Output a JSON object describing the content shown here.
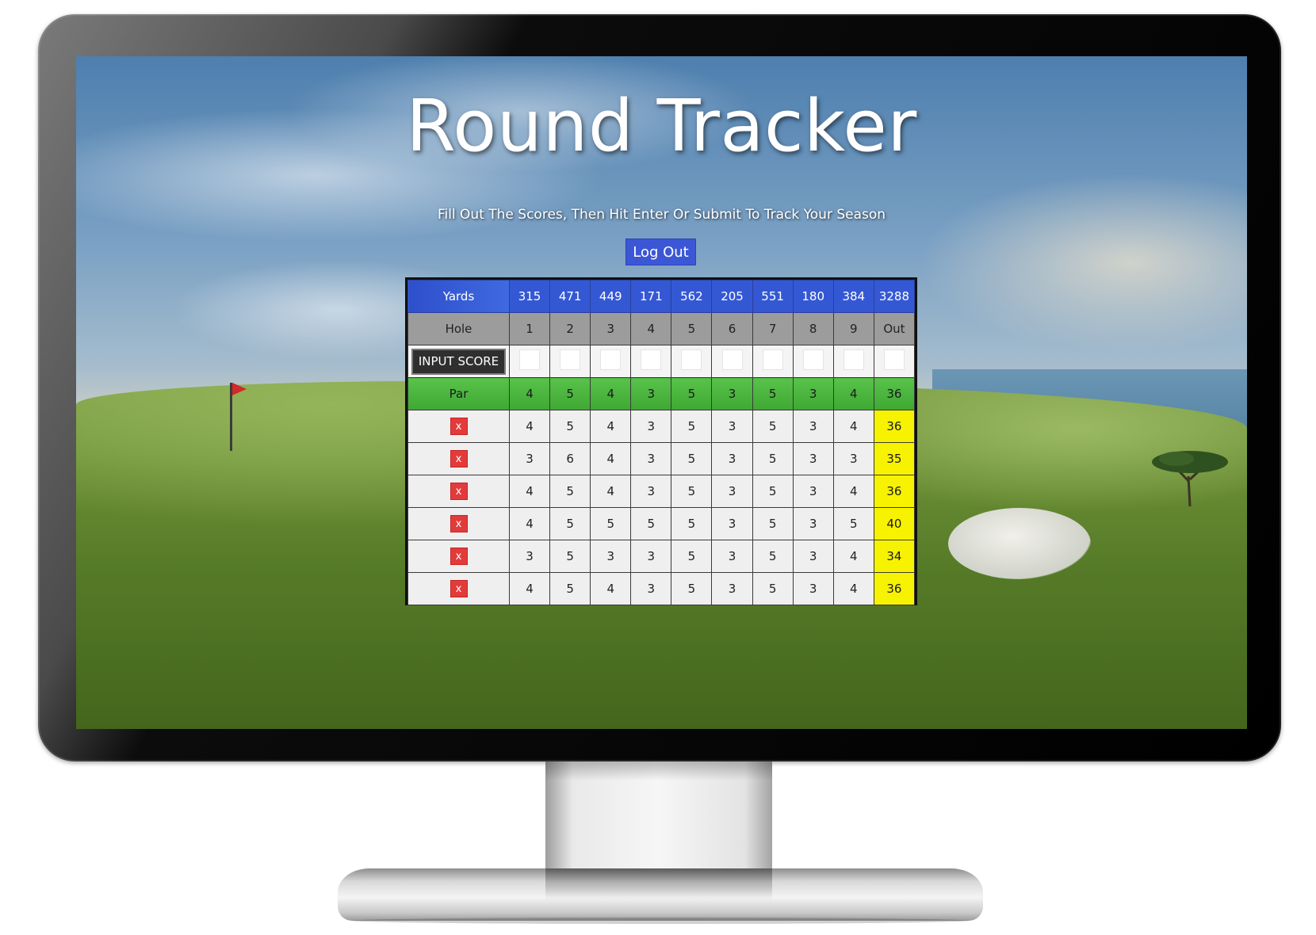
{
  "app": {
    "title": "Round Tracker",
    "subtitle": "Fill Out The Scores, Then Hit Enter Or Submit To Track Your Season",
    "logout_label": "Log Out"
  },
  "scorecard": {
    "yards": {
      "label": "Yards",
      "values": [
        "315",
        "471",
        "449",
        "171",
        "562",
        "205",
        "551",
        "180",
        "384"
      ],
      "total": "3288"
    },
    "hole": {
      "label": "Hole",
      "values": [
        "1",
        "2",
        "3",
        "4",
        "5",
        "6",
        "7",
        "8",
        "9"
      ],
      "total": "Out"
    },
    "input": {
      "button_label": "INPUT SCORE"
    },
    "par": {
      "label": "Par",
      "values": [
        "4",
        "5",
        "4",
        "3",
        "5",
        "3",
        "5",
        "3",
        "4"
      ],
      "total": "36"
    },
    "delete_label": "x",
    "rounds": [
      {
        "scores": [
          "4",
          "5",
          "4",
          "3",
          "5",
          "3",
          "5",
          "3",
          "4"
        ],
        "total": "36"
      },
      {
        "scores": [
          "3",
          "6",
          "4",
          "3",
          "5",
          "3",
          "5",
          "3",
          "3"
        ],
        "total": "35"
      },
      {
        "scores": [
          "4",
          "5",
          "4",
          "3",
          "5",
          "3",
          "5",
          "3",
          "4"
        ],
        "total": "36"
      },
      {
        "scores": [
          "4",
          "5",
          "5",
          "5",
          "5",
          "3",
          "5",
          "3",
          "5"
        ],
        "total": "40"
      },
      {
        "scores": [
          "3",
          "5",
          "3",
          "3",
          "5",
          "3",
          "5",
          "3",
          "4"
        ],
        "total": "34"
      },
      {
        "scores": [
          "4",
          "5",
          "4",
          "3",
          "5",
          "3",
          "5",
          "3",
          "4"
        ],
        "total": "36"
      }
    ]
  },
  "colors": {
    "yards_row": "#3458d4",
    "hole_row": "#9c9c9c",
    "par_row": "#4bb53e",
    "total_cell": "#f6f200",
    "delete_button": "#e23b3b",
    "logout_button": "#3b57d6"
  }
}
